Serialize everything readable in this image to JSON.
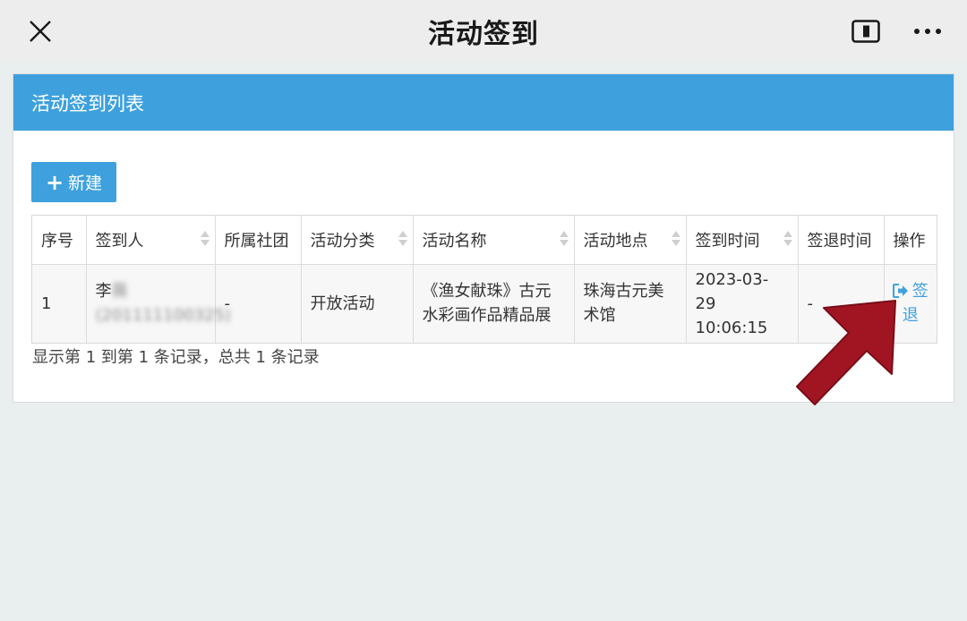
{
  "topbar": {
    "title": "活动签到",
    "icons": {
      "close": "close-icon",
      "float": "float-window-icon",
      "more": "more-icon"
    }
  },
  "panel": {
    "heading": "活动签到列表",
    "new_button": {
      "icon": "plus-icon",
      "label": "新建"
    }
  },
  "table": {
    "columns": [
      "序号",
      "签到人",
      "所属社团",
      "活动分类",
      "活动名称",
      "活动地点",
      "签到时间",
      "签退时间",
      "操作"
    ],
    "rows": [
      {
        "index": "1",
        "person_name": "李",
        "person_name_blurred": "薇",
        "person_id_blurred": "(201111100325)",
        "club": "-",
        "category": "开放活动",
        "activity_name": "《渔女献珠》古元水彩画作品精品展",
        "location": "珠海古元美术馆",
        "signin_date": "2023-03-29",
        "signin_time": "10:06:15",
        "signout_time": "-",
        "action_icon": "sign-out-icon",
        "action_label": "签退"
      }
    ]
  },
  "summary": "显示第 1 到第 1 条记录，总共 1 条记录",
  "colors": {
    "accent": "#3ea1dd",
    "arrow": "#a11523",
    "background": "#e9eeee"
  }
}
